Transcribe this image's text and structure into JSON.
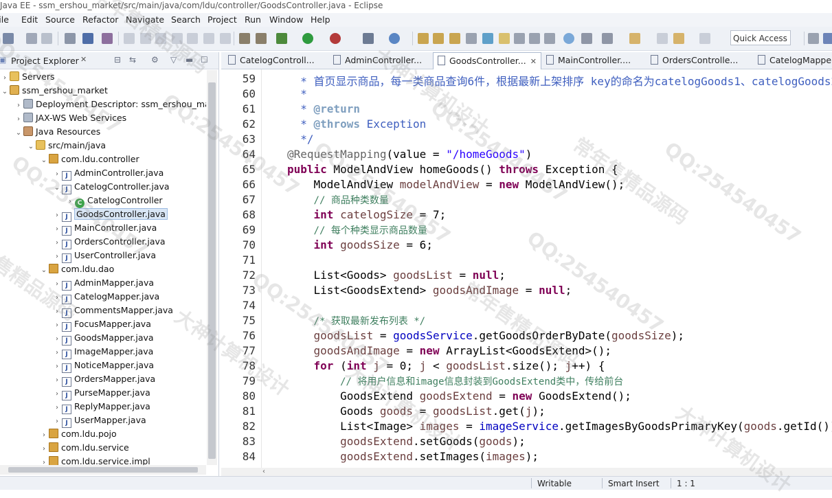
{
  "window": {
    "title": "Java EE - ssm_ershou_market/src/main/java/com/ldu/controller/GoodsController.java - Eclipse"
  },
  "menu": [
    "File",
    "Edit",
    "Source",
    "Refactor",
    "Navigate",
    "Search",
    "Project",
    "Run",
    "Window",
    "Help"
  ],
  "toolbar": {
    "quick_access": "Quick Access"
  },
  "project_explorer": {
    "title": "Project Explorer",
    "items": [
      {
        "label": "Servers"
      },
      {
        "label": "ssm_ershou_market"
      },
      {
        "label": "Deployment Descriptor: ssm_ershou_market"
      },
      {
        "label": "JAX-WS Web Services"
      },
      {
        "label": "Java Resources"
      },
      {
        "label": "src/main/java"
      },
      {
        "label": "com.ldu.controller"
      },
      {
        "label": "AdminController.java"
      },
      {
        "label": "CatelogController.java"
      },
      {
        "label": "CatelogController"
      },
      {
        "label": "GoodsController.java"
      },
      {
        "label": "MainController.java"
      },
      {
        "label": "OrdersController.java"
      },
      {
        "label": "UserController.java"
      },
      {
        "label": "com.ldu.dao"
      },
      {
        "label": "AdminMapper.java"
      },
      {
        "label": "CatelogMapper.java"
      },
      {
        "label": "CommentsMapper.java"
      },
      {
        "label": "FocusMapper.java"
      },
      {
        "label": "GoodsMapper.java"
      },
      {
        "label": "ImageMapper.java"
      },
      {
        "label": "NoticeMapper.java"
      },
      {
        "label": "OrdersMapper.java"
      },
      {
        "label": "PurseMapper.java"
      },
      {
        "label": "ReplyMapper.java"
      },
      {
        "label": "UserMapper.java"
      },
      {
        "label": "com.ldu.pojo"
      },
      {
        "label": "com.ldu.service"
      },
      {
        "label": "com.ldu.service.impl"
      }
    ]
  },
  "editor": {
    "tabs": [
      {
        "label": "CatelogControll..."
      },
      {
        "label": "AdminController..."
      },
      {
        "label": "GoodsController..."
      },
      {
        "label": "MainController...."
      },
      {
        "label": "OrdersControlle..."
      },
      {
        "label": "CatelogMapper...."
      }
    ],
    "active_tab": "GoodsController...",
    "line_numbers": [
      "59",
      "60",
      "61",
      "62",
      "63",
      "64",
      "65",
      "66",
      "67",
      "68",
      "69",
      "70",
      "71",
      "72",
      "73",
      "74",
      "75",
      "76",
      "77",
      "78",
      "79",
      "80",
      "81",
      "82",
      "83",
      "84"
    ]
  },
  "status": {
    "mode": "Writable",
    "insert": "Smart Insert",
    "position": "1 : 1"
  },
  "watermark": {
    "text_a": "QQ:254540457",
    "text_b": "大神计算机设计",
    "text_c": "常年售精品源码"
  },
  "colors": {
    "keyword": "#7f0055",
    "comment": "#3f7f5f",
    "javadoc": "#3f5fbf",
    "string": "#2a00ff",
    "field": "#6a3e3e",
    "selection": "#d9e6f5"
  }
}
